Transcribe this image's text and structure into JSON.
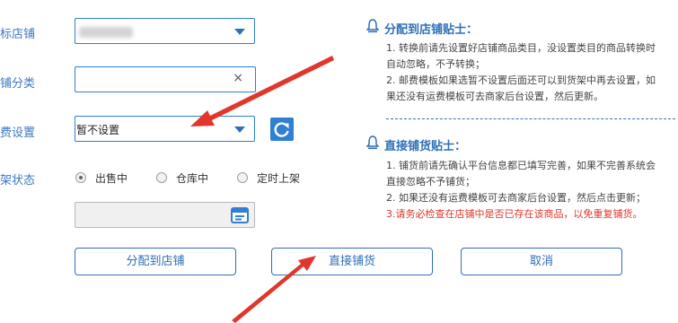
{
  "form": {
    "target_store_label": "目标店铺",
    "store_category_label": "店铺分类",
    "store_category_clear": "×",
    "shipping_label": "邮费设置",
    "shipping_value": "暂不设置",
    "listing_status_label": "上架状态",
    "status_options": [
      "出售中",
      "仓库中",
      "定时上架"
    ],
    "status_selected": "出售中"
  },
  "actions": {
    "assign_label": "分配到店铺",
    "direct_label": "直接铺货",
    "cancel_label": "取消"
  },
  "tips": {
    "assign_title": "分配到店铺贴士：",
    "assign_lines": [
      "1. 转换前请先设置好店铺商品类目，没设置类目的商品转换时",
      "自动忽略，不予转换；",
      "2. 邮费模板如果选暂不设置后面还可以到货架中再去设置，如",
      "果还没有运费模板可去商家后台设置，然后更新。"
    ],
    "direct_title": "直接铺货贴士：",
    "direct_lines": [
      "1. 铺货前请先确认平台信息都已填写完善，如果不完善系统会",
      "直接忽略不予铺货；",
      "2. 如果还没有运费模板可去商家后台设置，然后点击更新；"
    ],
    "direct_warning": "3.请务必检查在店铺中是否已存在该商品，以免重复铺货。"
  },
  "colors": {
    "accent": "#2f7fd2",
    "label_blue": "#3a78c3",
    "annotation_red": "#e0362b",
    "warning_red": "#e0362b"
  }
}
